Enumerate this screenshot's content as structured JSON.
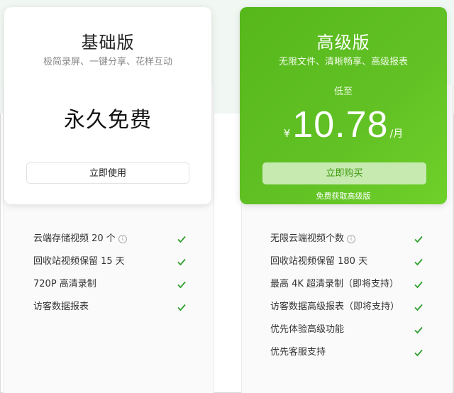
{
  "plans": {
    "basic": {
      "title": "基础版",
      "subtitle": "极简录屏、一键分享、花样互动",
      "price_text": "永久免费",
      "button_label": "立即使用",
      "features": [
        {
          "text": "云端存储视频 20 个",
          "info": true
        },
        {
          "text": "回收站视频保留 15 天",
          "info": false
        },
        {
          "text": "720P 高清录制",
          "info": false
        },
        {
          "text": "访客数据报表",
          "info": false
        }
      ]
    },
    "pro": {
      "title": "高级版",
      "subtitle": "无限文件、清晰畅享、高级报表",
      "price_prefix": "低至",
      "currency": "¥",
      "price": "10.78",
      "unit": "/月",
      "button_label": "立即购买",
      "note": "免费获取高级版",
      "features": [
        {
          "text": "无限云端视频个数",
          "info": true
        },
        {
          "text": "回收站视频保留 180 天",
          "info": false
        },
        {
          "text": "最高 4K 超清录制（即将支持）",
          "info": false
        },
        {
          "text": "访客数据高级报表（即将支持）",
          "info": false
        },
        {
          "text": "优先体验高级功能",
          "info": false
        },
        {
          "text": "优先客服支持",
          "info": false
        }
      ]
    }
  },
  "icons": {
    "info": "info-icon",
    "check": "check-icon"
  },
  "colors": {
    "accent": "#5cbd1f",
    "check": "#2e9f2e",
    "buy_button_bg": "#c7eab1"
  }
}
